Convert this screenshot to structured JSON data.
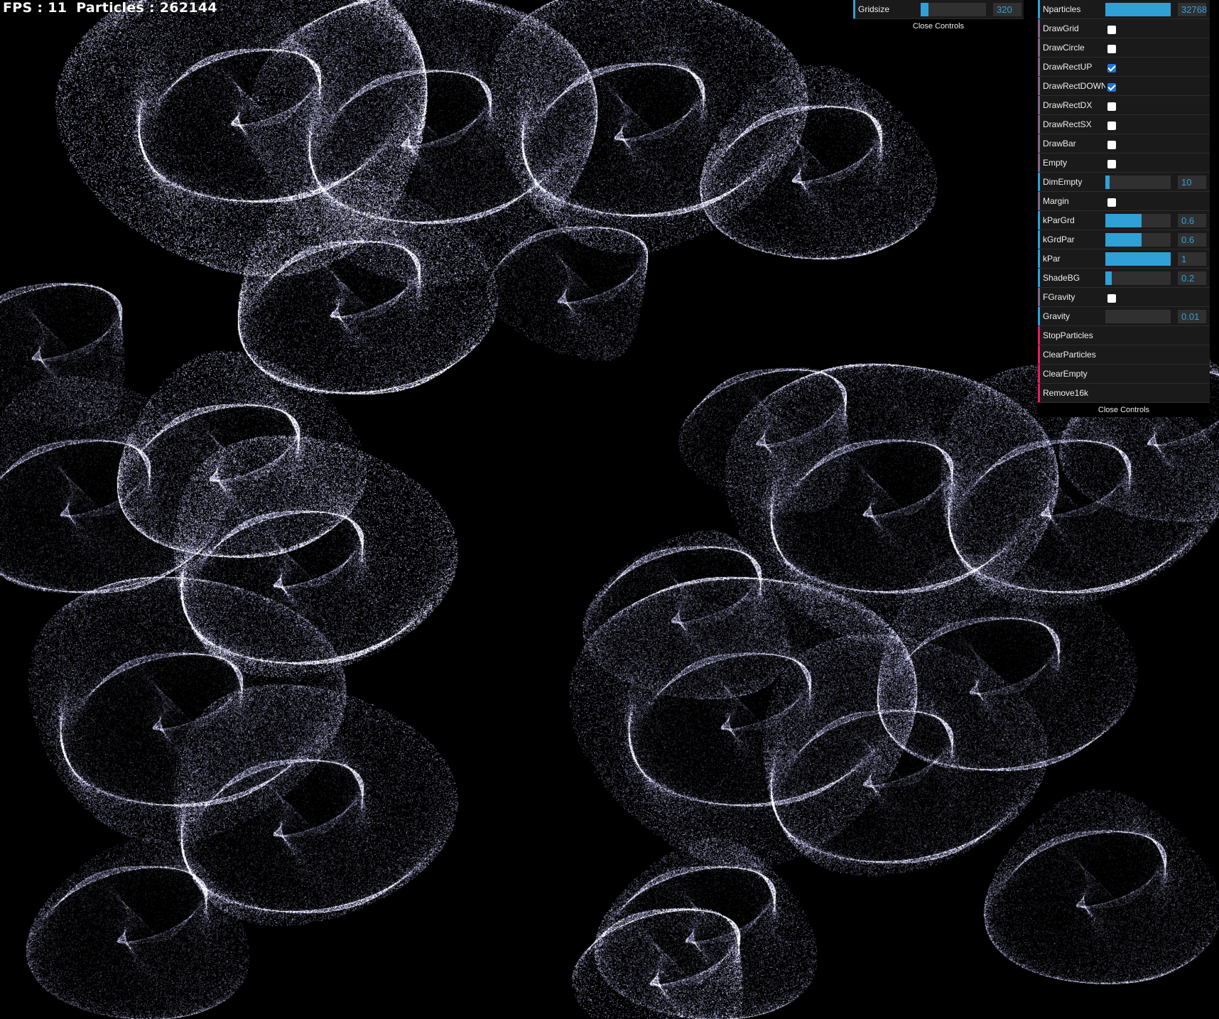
{
  "hud": {
    "fps_label": "FPS : 11",
    "particles_label": "Particles : 262144"
  },
  "gui_small": {
    "controls": [
      {
        "label": "Gridsize",
        "type": "number",
        "value": "320",
        "fraction": 0.12
      }
    ],
    "close_label": "Close Controls"
  },
  "gui_main": {
    "controls": [
      {
        "label": "Nparticles",
        "type": "number",
        "value": "32768",
        "fraction": 1.0
      },
      {
        "label": "DrawGrid",
        "type": "boolean",
        "checked": false
      },
      {
        "label": "DrawCircle",
        "type": "boolean",
        "checked": false
      },
      {
        "label": "DrawRectUP",
        "type": "boolean",
        "checked": true
      },
      {
        "label": "DrawRectDOWN",
        "type": "boolean",
        "checked": true
      },
      {
        "label": "DrawRectDX",
        "type": "boolean",
        "checked": false
      },
      {
        "label": "DrawRectSX",
        "type": "boolean",
        "checked": false
      },
      {
        "label": "DrawBar",
        "type": "boolean",
        "checked": false
      },
      {
        "label": "Empty",
        "type": "boolean",
        "checked": false
      },
      {
        "label": "DimEmpty",
        "type": "number",
        "value": "10",
        "fraction": 0.05
      },
      {
        "label": "Margin",
        "type": "boolean",
        "checked": false
      },
      {
        "label": "kParGrd",
        "type": "number",
        "value": "0.6",
        "fraction": 0.55
      },
      {
        "label": "kGrdPar",
        "type": "number",
        "value": "0.6",
        "fraction": 0.55
      },
      {
        "label": "kPar",
        "type": "number",
        "value": "1",
        "fraction": 1.0
      },
      {
        "label": "ShadeBG",
        "type": "number",
        "value": "0.2",
        "fraction": 0.1
      },
      {
        "label": "FGravity",
        "type": "boolean",
        "checked": false
      },
      {
        "label": "Gravity",
        "type": "number",
        "value": "0.01",
        "fraction": 0.0
      },
      {
        "label": "StopParticles",
        "type": "function"
      },
      {
        "label": "ClearParticles",
        "type": "function"
      },
      {
        "label": "ClearEmpty",
        "type": "function"
      },
      {
        "label": "Remove16k",
        "type": "function"
      }
    ],
    "close_label": "Close Controls"
  },
  "colors": {
    "number_accent": "#2fa1d6",
    "boolean_accent": "#806787",
    "function_accent": "#e61d5f",
    "panel_bg": "#1a1a1a",
    "particle_tint": "#c8c8ff"
  }
}
